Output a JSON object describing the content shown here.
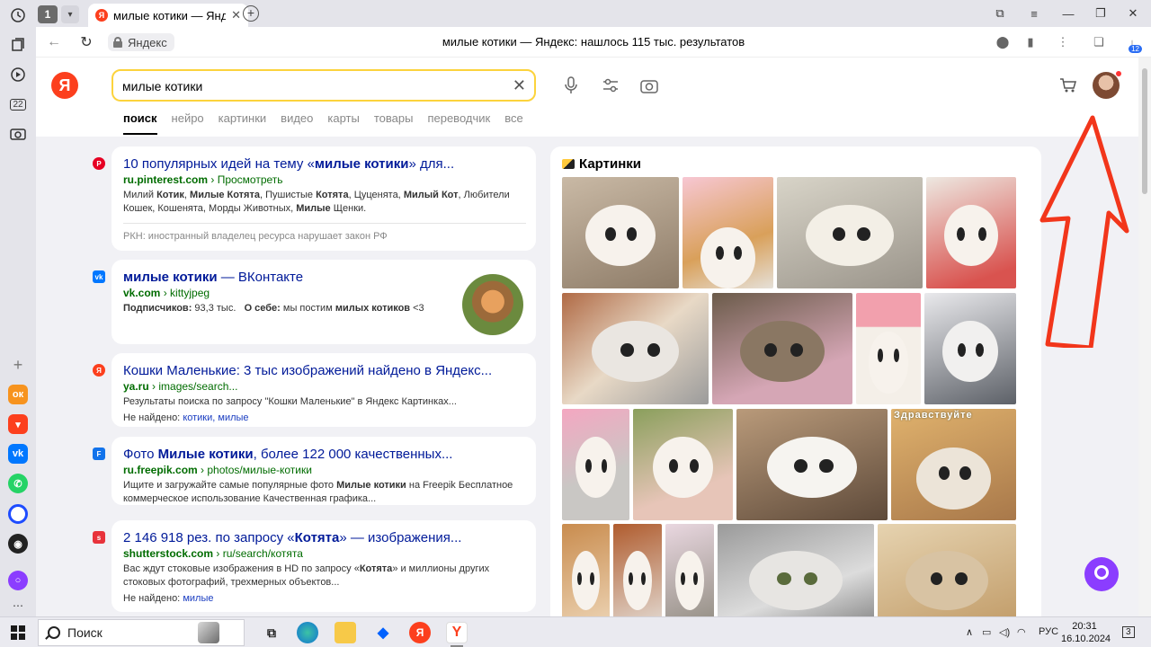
{
  "browser": {
    "tab_count": "1",
    "tab_title": "милые котики — Яндекс",
    "site_label": "Яндекс",
    "page_heading": "милые котики — Яндекс: нашлось 115 тыс. результатов",
    "downloads_badge": "12",
    "sidebar_counter": "22"
  },
  "search": {
    "query": "милые котики",
    "tabs": [
      "поиск",
      "нейро",
      "картинки",
      "видео",
      "карты",
      "товары",
      "переводчик",
      "все"
    ]
  },
  "results": [
    {
      "title_pre": "10 популярных идей на тему «",
      "title_bold": "милые котики",
      "title_post": "» для...",
      "domain": "ru.pinterest.com",
      "path": "Просмотреть",
      "snippet_html_parts": [
        "Милий ",
        "Котик",
        ", ",
        "Милые Котята",
        ", Пушистые ",
        "Котята",
        ", Цуценята, ",
        "Милый Кот",
        ", Любители Кошек, Кошенята, Морды Животных, ",
        "Милые",
        " Щенки."
      ],
      "rkn": "РКН: иностранный владелец ресурса нарушает закон РФ"
    },
    {
      "title_bold": "милые котики",
      "title_post": " — ВКонтакте",
      "domain": "vk.com",
      "path": "kittyjpeg",
      "subs_label": "Подписчиков:",
      "subs_value": "93,3 тыс.",
      "about_label": "О себе:",
      "about_pre": "мы постим ",
      "about_bold": "милых котиков",
      "about_post": " <3"
    },
    {
      "title": "Кошки Маленькие: 3 тыс изображений найдено в Яндекс...",
      "domain": "ya.ru",
      "path": "images/search...",
      "snippet": "Результаты поиска по запросу \"Кошки Маленькие\" в Яндекс Картинках...",
      "not_found_label": "Не найдено:",
      "not_found_words": "котики, милые"
    },
    {
      "title_pre": "Фото ",
      "title_bold": "Милые котики",
      "title_post": ", более 122 000 качественных...",
      "domain": "ru.freepik.com",
      "path": "photos/милые-котики",
      "snippet_pre": "Ищите и загружайте самые популярные фото ",
      "snippet_bold": "Милые котики",
      "snippet_post": " на Freepik Бесплатное коммерческое использование Качественная графика..."
    },
    {
      "title_pre": "2 146 918 рез. по запросу «",
      "title_bold": "Котята",
      "title_post": "» — изображения...",
      "domain": "shutterstock.com",
      "path": "ru/search/котята",
      "snippet_pre": "Вас ждут стоковые изображения в HD по запросу «",
      "snippet_bold": "Котята",
      "snippet_post": "» и миллионы других стоковых фотографий, трехмерных объектов...",
      "not_found_label": "Не найдено:",
      "not_found_words": "милые"
    }
  ],
  "images_panel": {
    "title": "Картинки",
    "greeting_overlay": "Здравствуйте"
  },
  "taskbar": {
    "search_placeholder": "Поиск",
    "lang": "РУС",
    "time": "20:31",
    "date": "16.10.2024",
    "notif_count": "3"
  },
  "colors": {
    "yandex_red": "#fc3f1d",
    "search_border": "#fcd33c",
    "link_blue": "#001a99",
    "url_green": "#006c00",
    "alice_purple": "#8b3dff",
    "annotation_arrow": "#f2361b"
  }
}
